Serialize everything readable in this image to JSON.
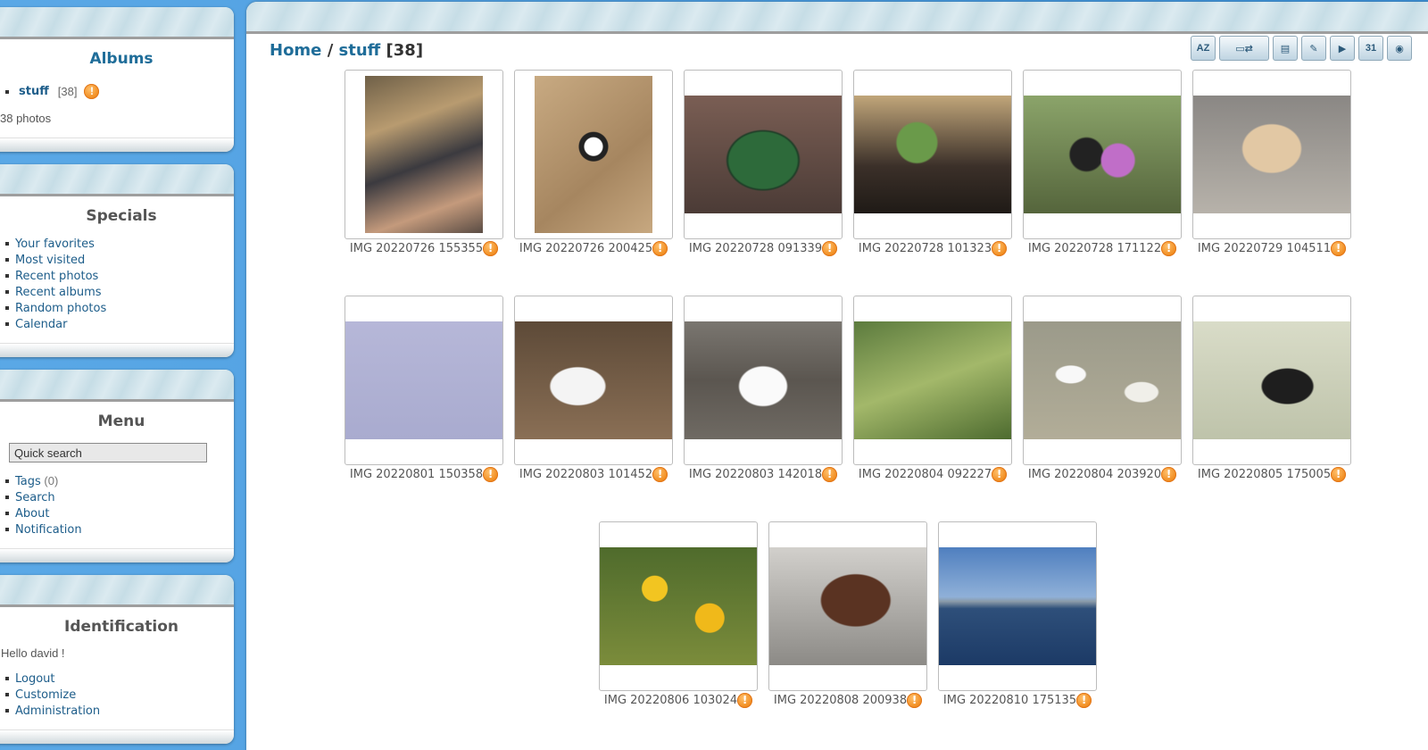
{
  "sidebar": {
    "albums": {
      "title": "Albums",
      "items": [
        {
          "label": "stuff",
          "count": "[38]"
        }
      ],
      "summary": "38 photos"
    },
    "specials": {
      "title": "Specials",
      "links": [
        "Your favorites",
        "Most visited",
        "Recent photos",
        "Recent albums",
        "Random photos",
        "Calendar"
      ]
    },
    "menu": {
      "title": "Menu",
      "search_placeholder": "Quick search",
      "links": [
        {
          "label": "Tags",
          "suffix": "(0)"
        },
        {
          "label": "Search",
          "suffix": ""
        },
        {
          "label": "About",
          "suffix": ""
        },
        {
          "label": "Notification",
          "suffix": ""
        }
      ]
    },
    "identification": {
      "title": "Identification",
      "greeting": "Hello david !",
      "links": [
        "Logout",
        "Customize",
        "Administration"
      ]
    }
  },
  "breadcrumb": {
    "home": "Home",
    "separator": "/",
    "album": "stuff",
    "count": "[38]"
  },
  "toolbar": {
    "icons": [
      "sort-order-icon",
      "display-mode-icon",
      "slideshow-icon",
      "edit-icon",
      "play-icon",
      "calendar-icon",
      "camera-icon"
    ],
    "labels": [
      "AZ",
      "▭⇄",
      "▤",
      "✎",
      "▶",
      "31",
      "◉"
    ]
  },
  "thumbnails": [
    {
      "caption": "IMG 20220726 155355",
      "orientation": "portrait"
    },
    {
      "caption": "IMG 20220726 200425",
      "orientation": "portrait"
    },
    {
      "caption": "IMG 20220728 091339",
      "orientation": "landscape"
    },
    {
      "caption": "IMG 20220728 101323",
      "orientation": "landscape"
    },
    {
      "caption": "IMG 20220728 171122",
      "orientation": "landscape"
    },
    {
      "caption": "IMG 20220729 104511",
      "orientation": "landscape"
    },
    {
      "caption": "IMG 20220801 150358",
      "orientation": "landscape"
    },
    {
      "caption": "IMG 20220803 101452",
      "orientation": "landscape"
    },
    {
      "caption": "IMG 20220803 142018",
      "orientation": "landscape"
    },
    {
      "caption": "IMG 20220804 092227",
      "orientation": "landscape"
    },
    {
      "caption": "IMG 20220804 203920",
      "orientation": "landscape"
    },
    {
      "caption": "IMG 20220805 175005",
      "orientation": "landscape"
    },
    {
      "caption": "IMG 20220806 103024",
      "orientation": "landscape"
    },
    {
      "caption": "IMG 20220808 200938",
      "orientation": "landscape"
    },
    {
      "caption": "IMG 20220810 175135",
      "orientation": "landscape"
    }
  ],
  "colors": {
    "background": "#3f93da",
    "link": "#1d5d8a",
    "info_badge": "#f08a1c"
  }
}
